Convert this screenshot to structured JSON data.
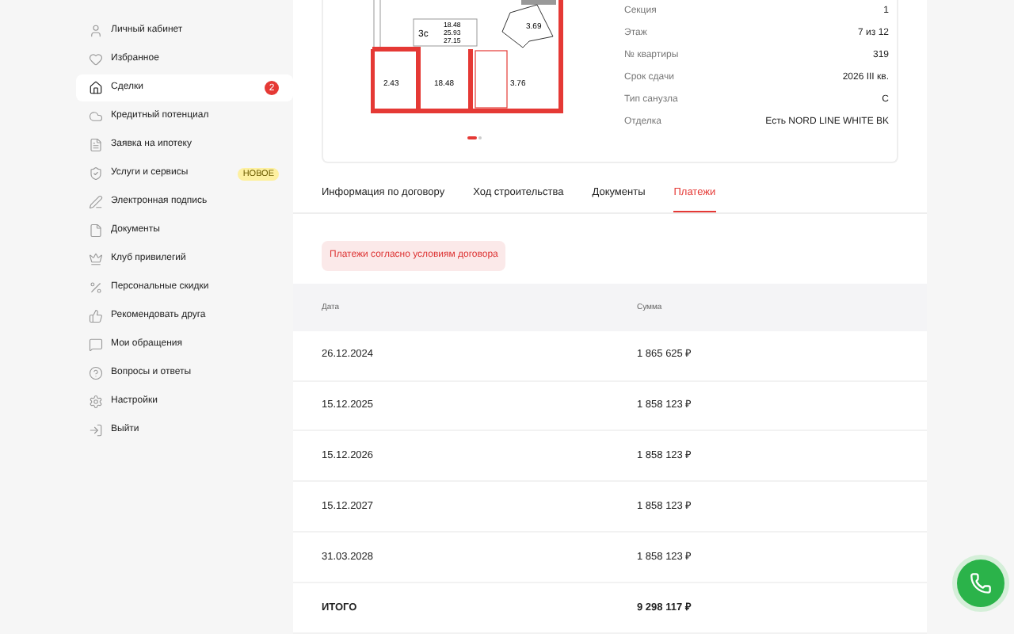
{
  "sidebar": {
    "items": [
      {
        "label": "Личный кабинет",
        "selected": false
      },
      {
        "label": "Избранное",
        "selected": false
      },
      {
        "label": "Сделки",
        "selected": true,
        "badge": {
          "kind": "count",
          "text": "2"
        }
      },
      {
        "label": "Кредитный потенциал",
        "selected": false
      },
      {
        "label": "Заявка на ипотеку",
        "selected": false
      },
      {
        "label": "Услуги и сервисы",
        "selected": false,
        "badge": {
          "kind": "tag",
          "text": "НОВОЕ"
        }
      },
      {
        "label": "Электронная подпись",
        "selected": false
      },
      {
        "label": "Документы",
        "selected": false
      },
      {
        "label": "Клуб привилегий",
        "selected": false
      },
      {
        "label": "Персональные скидки",
        "selected": false
      },
      {
        "label": "Рекомендовать друга",
        "selected": false
      },
      {
        "label": "Мои обращения",
        "selected": false
      },
      {
        "label": "Вопросы и ответы",
        "selected": false
      },
      {
        "label": "Настройки",
        "selected": false
      },
      {
        "label": "Выйти",
        "selected": false
      }
    ]
  },
  "floor_plan": {
    "room_type": "3с",
    "areas": [
      "18.48",
      "25.93",
      "27.15"
    ],
    "rooms": [
      "2.43",
      "18.48",
      "3.69",
      "3.76"
    ],
    "carousel": [
      {
        "selected": true
      },
      {
        "selected": false
      }
    ]
  },
  "details": [
    {
      "label": "Секция",
      "value": "1"
    },
    {
      "label": "Этаж",
      "value": "7 из 12"
    },
    {
      "label": "№ квартиры",
      "value": "319"
    },
    {
      "label": "Срок сдачи",
      "value": "2026 III кв."
    },
    {
      "label": "Тип санузла",
      "value": "С"
    },
    {
      "label": "Отделка",
      "value": "Есть NORD LINE WHITE BK"
    }
  ],
  "tabs": [
    {
      "label": "Информация по договору",
      "selected": false
    },
    {
      "label": "Ход строительства",
      "selected": false
    },
    {
      "label": "Документы",
      "selected": false
    },
    {
      "label": "Платежи",
      "selected": true
    }
  ],
  "notice": "Платежи согласно условиям договора",
  "table": {
    "columns": [
      "Дата",
      "Сумма"
    ],
    "rows": [
      [
        "26.12.2024",
        "1 865 625 ₽"
      ],
      [
        "15.12.2025",
        "1 858 123 ₽"
      ],
      [
        "15.12.2026",
        "1 858 123 ₽"
      ],
      [
        "15.12.2027",
        "1 858 123 ₽"
      ],
      [
        "31.03.2028",
        "1 858 123 ₽"
      ]
    ],
    "total": [
      "ИТОГО",
      "9 298 117 ₽"
    ]
  }
}
